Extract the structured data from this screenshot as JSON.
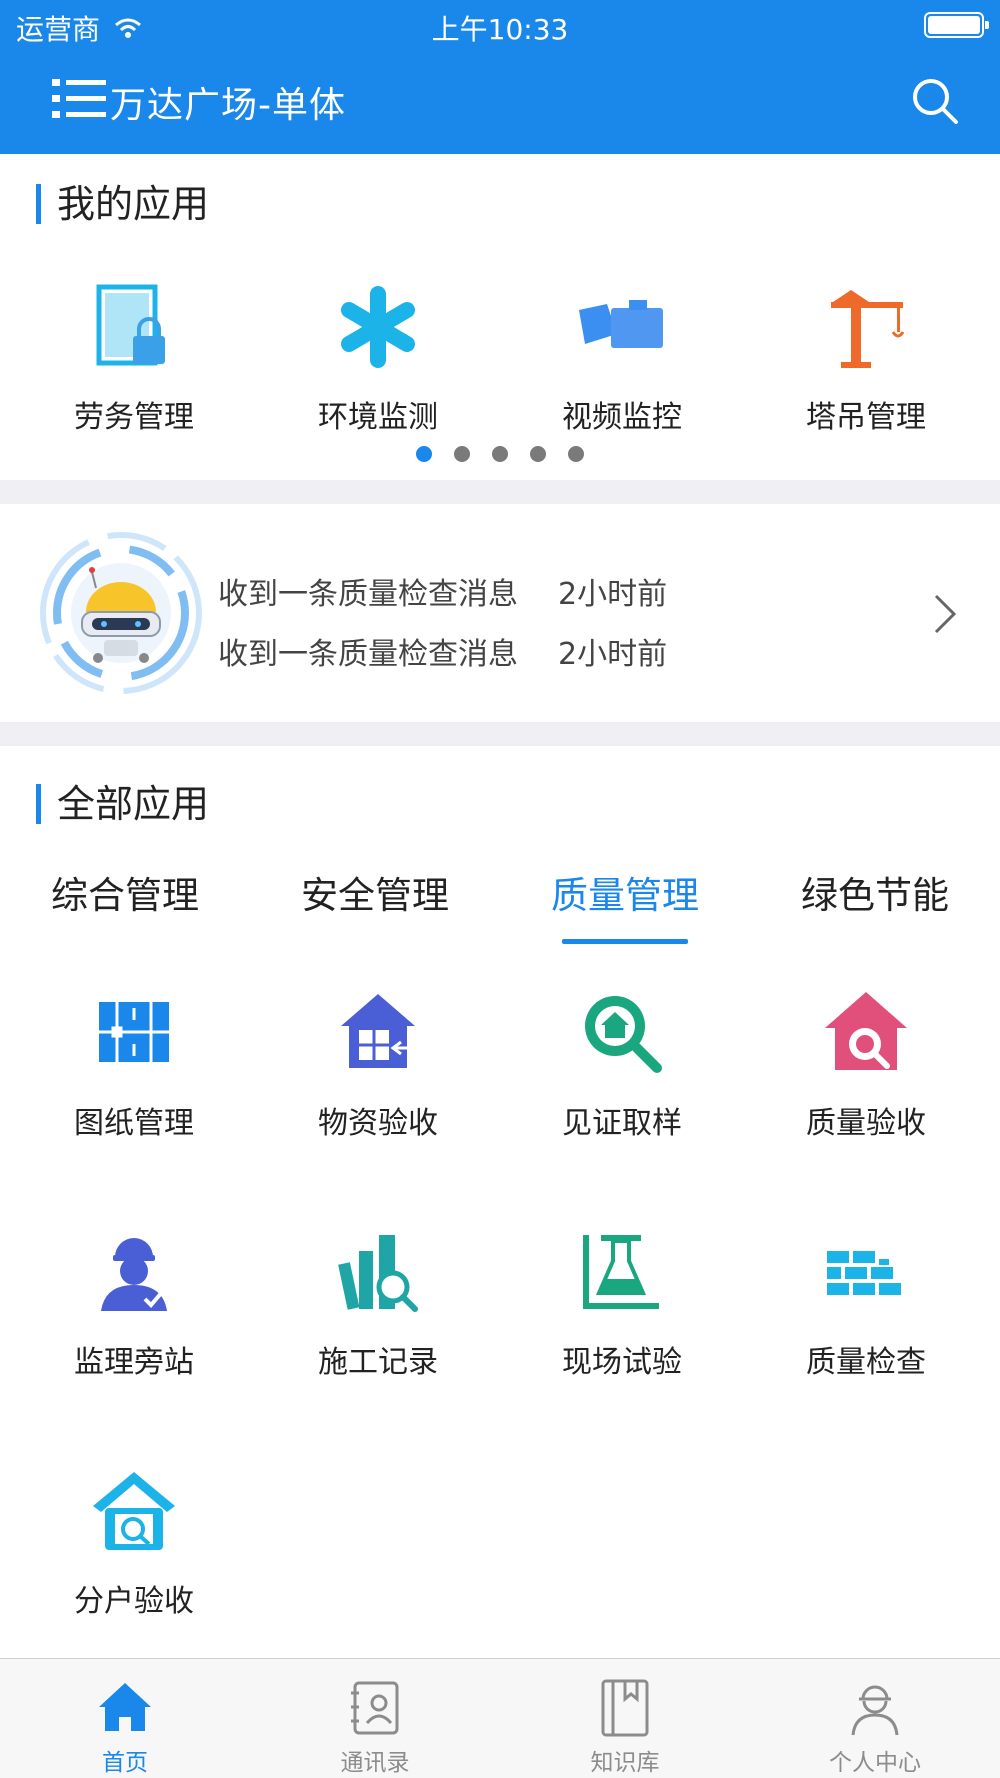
{
  "status_bar": {
    "carrier": "运营商",
    "time": "上午10:33"
  },
  "nav": {
    "title": "万达广场-单体"
  },
  "my_apps": {
    "title": "我的应用",
    "items": [
      {
        "label": "劳务管理",
        "icon": "labor-door-lock-icon"
      },
      {
        "label": "环境监测",
        "icon": "asterisk-icon"
      },
      {
        "label": "视频监控",
        "icon": "camera-icon"
      },
      {
        "label": "塔吊管理",
        "icon": "tower-crane-icon"
      }
    ],
    "page_count": 5,
    "active_page": 1
  },
  "messages": {
    "items": [
      {
        "text": "收到一条质量检查消息",
        "time": "2小时前"
      },
      {
        "text": "收到一条质量检查消息",
        "time": "2小时前"
      }
    ]
  },
  "all_apps": {
    "title": "全部应用",
    "tabs": [
      {
        "label": "综合管理"
      },
      {
        "label": "安全管理"
      },
      {
        "label": "质量管理"
      },
      {
        "label": "绿色节能"
      }
    ],
    "active_tab": 2,
    "items": [
      {
        "label": "图纸管理",
        "icon": "blueprint-icon"
      },
      {
        "label": "物资验收",
        "icon": "warehouse-icon"
      },
      {
        "label": "见证取样",
        "icon": "search-house-icon"
      },
      {
        "label": "质量验收",
        "icon": "house-inspect-icon"
      },
      {
        "label": "监理旁站",
        "icon": "supervisor-icon"
      },
      {
        "label": "施工记录",
        "icon": "books-icon"
      },
      {
        "label": "现场试验",
        "icon": "flask-icon"
      },
      {
        "label": "质量检查",
        "icon": "bricks-icon"
      },
      {
        "label": "分户验收",
        "icon": "home-check-icon"
      }
    ]
  },
  "tabbar": {
    "items": [
      {
        "label": "首页",
        "icon": "home-icon"
      },
      {
        "label": "通讯录",
        "icon": "contacts-icon"
      },
      {
        "label": "知识库",
        "icon": "book-icon"
      },
      {
        "label": "个人中心",
        "icon": "worker-icon"
      }
    ],
    "active": 0
  },
  "colors": {
    "primary": "#1a87ea",
    "crane_orange": "#ee6a2a",
    "cyan": "#1cb3e8",
    "green": "#1aa67e",
    "pink": "#e0507a",
    "indigo": "#4a5fd6",
    "teal": "#1fa5a6"
  }
}
